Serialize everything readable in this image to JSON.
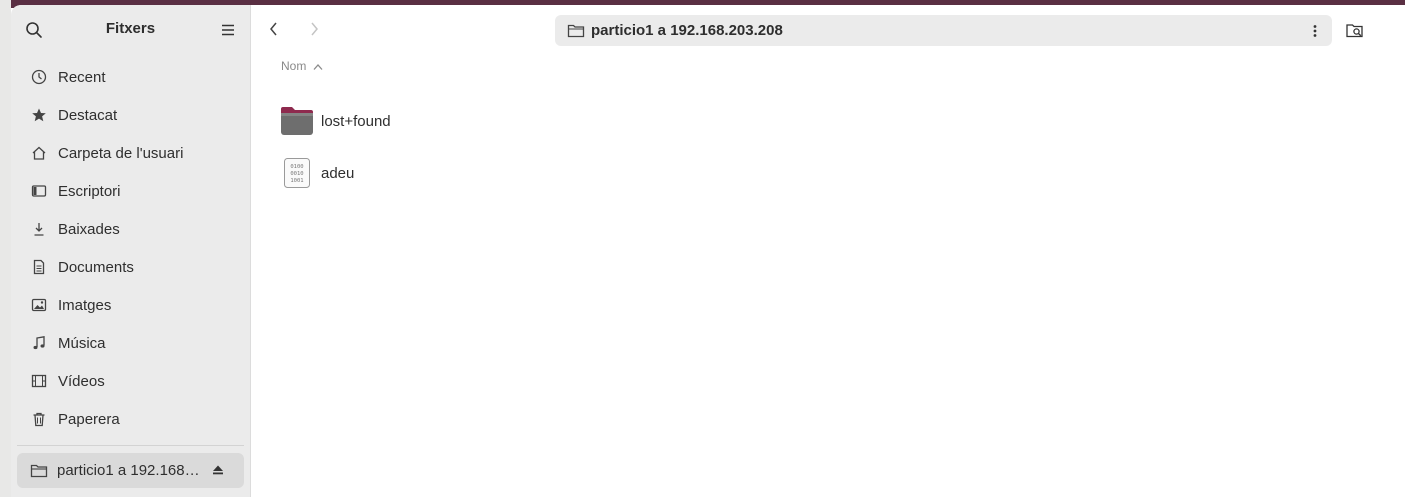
{
  "sidebar": {
    "title": "Fitxers",
    "items": [
      {
        "label": "Recent",
        "icon": "clock-icon"
      },
      {
        "label": "Destacat",
        "icon": "star-icon"
      },
      {
        "label": "Carpeta de l'usuari",
        "icon": "home-icon"
      },
      {
        "label": "Escriptori",
        "icon": "desktop-icon"
      },
      {
        "label": "Baixades",
        "icon": "download-icon"
      },
      {
        "label": "Documents",
        "icon": "document-icon"
      },
      {
        "label": "Imatges",
        "icon": "image-icon"
      },
      {
        "label": "Música",
        "icon": "music-icon"
      },
      {
        "label": "Vídeos",
        "icon": "video-icon"
      },
      {
        "label": "Paperera",
        "icon": "trash-icon"
      }
    ],
    "mount": {
      "label": "particio1 a 192.168.203.208",
      "icon": "network-folder-icon",
      "selected": true
    }
  },
  "pathbar": {
    "location": "particio1 a 192.168.203.208"
  },
  "list": {
    "column": "Nom",
    "sort": "ascending",
    "files": [
      {
        "name": "lost+found",
        "type": "folder"
      },
      {
        "name": "adeu",
        "type": "binary-file"
      }
    ]
  },
  "colors": {
    "desktop_bg": "#5a2f43",
    "sidebar_bg": "#ebebeb",
    "selected_bg": "#dadada",
    "folder_tab": "#8e2a4e",
    "folder_body": "#6e6e6e"
  }
}
